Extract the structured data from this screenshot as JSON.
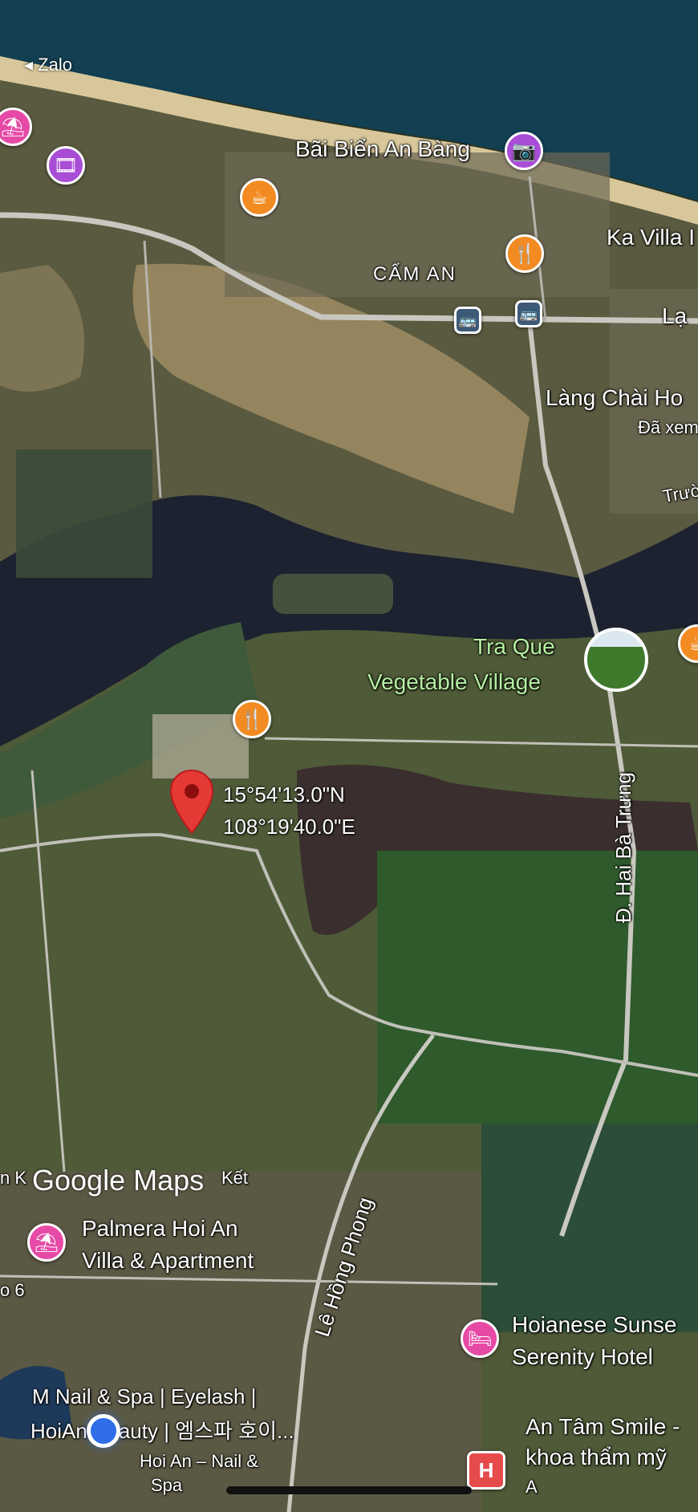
{
  "app": {
    "back_label": "◂ Zalo"
  },
  "map": {
    "watermark": "Google Maps",
    "coordinates": {
      "lat": "15°54'13.0\"N",
      "lng": "108°19'40.0\"E"
    },
    "labels": {
      "beach": "Bãi Biển An Bàng",
      "ka_villa": "Ka Villa I",
      "cam_an": "CẨM AN",
      "lang_chai": "Làng Chài Ho",
      "lang_chai_sub": "Đã xem",
      "road_la": "Lạ",
      "road_truo": "Trườ",
      "tra_que_1": "Tra Que",
      "tra_que_2": "Vegetable Village",
      "hai_ba_trung": "Đ. Hai Bà Trưng",
      "le_hong_phong": "Lê Hồng Phong",
      "palmera_1": "Palmera Hoi An",
      "palmera_2": "Villa & Apartment",
      "ket": "Kết",
      "n_k": "n K",
      "so6": "o 6",
      "hoianese_1": "Hoianese Sunse",
      "hoianese_2": "Serenity Hotel",
      "mnail_1": "M Nail & Spa | Eyelash |",
      "mnail_2": "HoiAn Beauty | 엠스파 호이...",
      "mnail_3": "Hoi An – Nail &",
      "mnail_4": "Spa",
      "antam_1": "An Tâm Smile -",
      "antam_2": "khoa thẩm mỹ",
      "antam_3": "A"
    },
    "icons": {
      "pin_beach": "camera-icon",
      "pin_cafe": "coffee-icon",
      "pin_restaurant": "fork-knife-icon",
      "pin_hotel": "bed-icon",
      "pin_hospital": "hospital-icon",
      "pin_bus": "bus-icon"
    },
    "glyphs": {
      "camera": "📷",
      "coffee": "☕",
      "fork": "🍴",
      "bed": "🛏",
      "bus": "🚌",
      "h": "H",
      "beach": "⛱",
      "film": "🎞"
    }
  }
}
